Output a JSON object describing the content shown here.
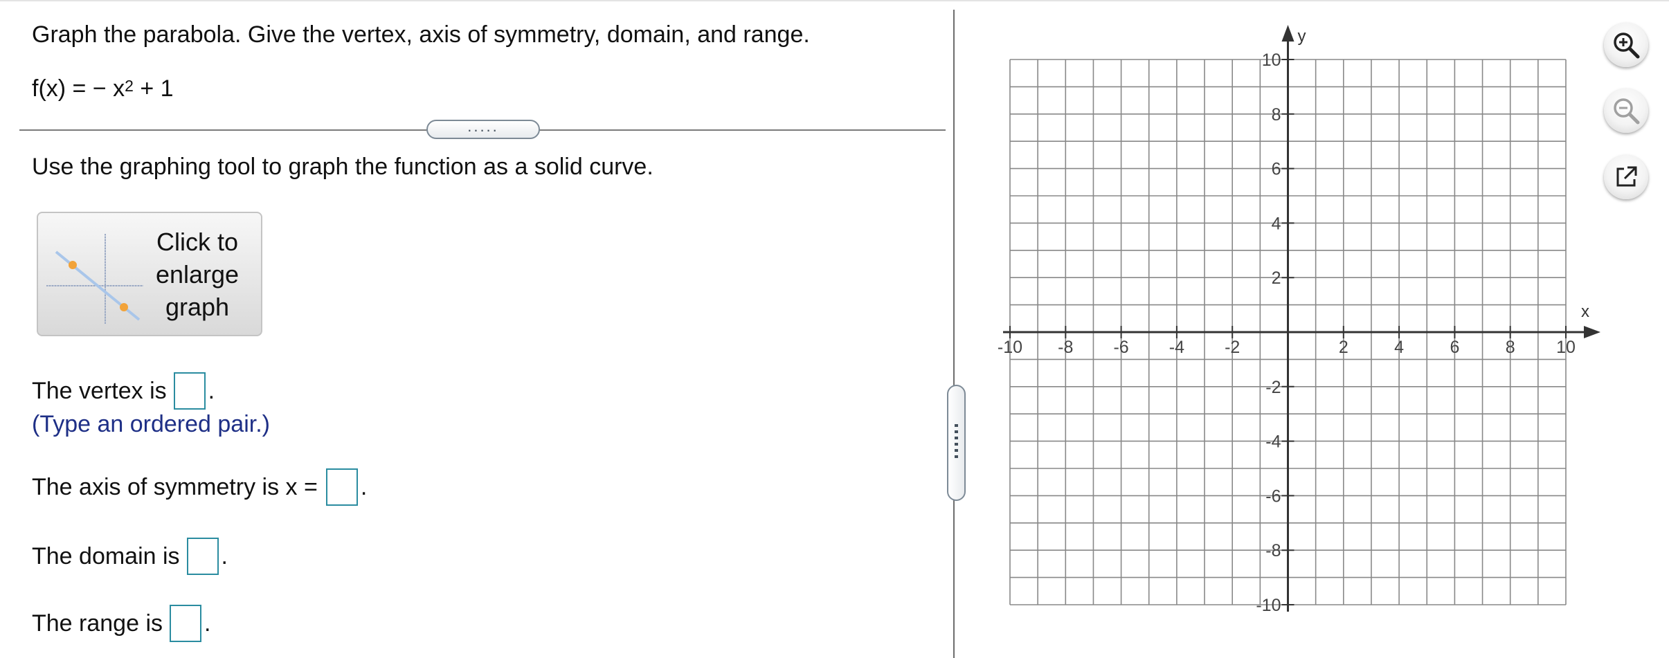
{
  "question": {
    "prompt": "Graph the parabola. Give the vertex, axis of symmetry, domain, and range.",
    "function_prefix": "f(x) = − x",
    "function_exponent": "2",
    "function_suffix": " + 1",
    "instruction": "Use the graphing tool to graph the function as a solid curve."
  },
  "collapse_handle": {
    "label": "....."
  },
  "enlarge_button": {
    "label": "Click to\nenlarge\ngraph"
  },
  "answers": {
    "vertex_label": "The vertex is",
    "vertex_hint": "(Type an ordered pair.)",
    "axis_label": "The axis of symmetry is x =",
    "domain_label": "The domain is",
    "range_label": "The range is",
    "terminator": "."
  },
  "graph": {
    "x_axis_label": "x",
    "y_axis_label": "y",
    "x_ticks": [
      "-10",
      "-8",
      "-6",
      "-4",
      "-2",
      "2",
      "4",
      "6",
      "8",
      "10"
    ],
    "y_ticks": [
      "10",
      "8",
      "6",
      "4",
      "2",
      "-2",
      "-4",
      "-6",
      "-8",
      "-10"
    ],
    "xlim": [
      -10,
      10
    ],
    "ylim": [
      -10,
      10
    ],
    "grid_step": 1,
    "grid_color": "#888888",
    "axis_color": "#333333"
  },
  "tools": {
    "zoom_in_icon": "zoom-in-icon",
    "zoom_out_icon": "zoom-out-icon",
    "popout_icon": "external-link-icon"
  },
  "colors": {
    "answer_box_border": "#2a8ca0",
    "hint_text": "#1e2f86",
    "thumbnail_line": "#a9c6ea",
    "thumbnail_point": "#f2a33a"
  }
}
